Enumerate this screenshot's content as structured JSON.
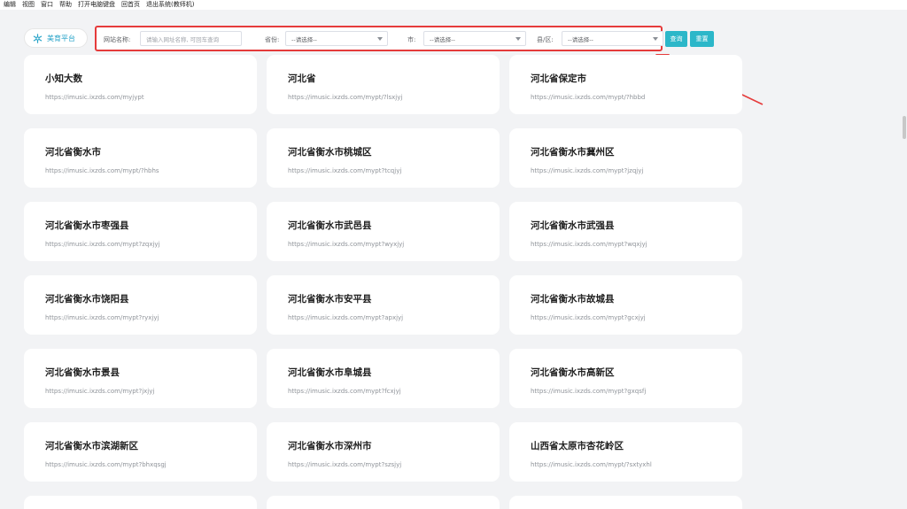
{
  "menu": [
    "编辑",
    "视图",
    "窗口",
    "帮助",
    "打开电脑键盘",
    "回首页",
    "退出系统(教师机)"
  ],
  "brand": {
    "label": "美育平台",
    "icon": "snowflake-logo-icon",
    "color": "#27a3c8"
  },
  "filters": {
    "site_name_label": "网站名称:",
    "site_name_placeholder": "请输入网址名称, 可回车查询",
    "province_label": "省份:",
    "province_value": "--请选择--",
    "city_label": "市:",
    "city_value": "--请选择--",
    "county_label": "县/区:",
    "county_value": "--请选择--"
  },
  "buttons": {
    "search": "查询",
    "reset": "重置"
  },
  "colors": {
    "accent": "#2cb7c9",
    "highlight": "#e53b3b"
  },
  "cards": [
    {
      "title": "小知大数",
      "url": "https://imusic.ixzds.com/myjypt"
    },
    {
      "title": "河北省",
      "url": "https://imusic.ixzds.com/mypt/?lsxjyj"
    },
    {
      "title": "河北省保定市",
      "url": "https://imusic.ixzds.com/mypt/?hbbd"
    },
    {
      "title": "河北省衡水市",
      "url": "https://imusic.ixzds.com/mypt/?hbhs"
    },
    {
      "title": "河北省衡水市桃城区",
      "url": "https://imusic.ixzds.com/mypt?tcqjyj"
    },
    {
      "title": "河北省衡水市冀州区",
      "url": "https://imusic.ixzds.com/mypt?jzqjyj"
    },
    {
      "title": "河北省衡水市枣强县",
      "url": "https://imusic.ixzds.com/mypt?zqxjyj"
    },
    {
      "title": "河北省衡水市武邑县",
      "url": "https://imusic.ixzds.com/mypt?wyxjyj"
    },
    {
      "title": "河北省衡水市武强县",
      "url": "https://imusic.ixzds.com/mypt?wqxjyj"
    },
    {
      "title": "河北省衡水市饶阳县",
      "url": "https://imusic.ixzds.com/mypt?ryxjyj"
    },
    {
      "title": "河北省衡水市安平县",
      "url": "https://imusic.ixzds.com/mypt?apxjyj"
    },
    {
      "title": "河北省衡水市故城县",
      "url": "https://imusic.ixzds.com/mypt?gcxjyj"
    },
    {
      "title": "河北省衡水市景县",
      "url": "https://imusic.ixzds.com/mypt?jxjyj"
    },
    {
      "title": "河北省衡水市阜城县",
      "url": "https://imusic.ixzds.com/mypt?fcxjyj"
    },
    {
      "title": "河北省衡水市高新区",
      "url": "https://imusic.ixzds.com/mypt?gxqsfj"
    },
    {
      "title": "河北省衡水市滨湖新区",
      "url": "https://imusic.ixzds.com/mypt?bhxqsgj"
    },
    {
      "title": "河北省衡水市深州市",
      "url": "https://imusic.ixzds.com/mypt?szsjyj"
    },
    {
      "title": "山西省太原市杏花岭区",
      "url": "https://imusic.ixzds.com/mypt/?sxtyxhl"
    }
  ]
}
